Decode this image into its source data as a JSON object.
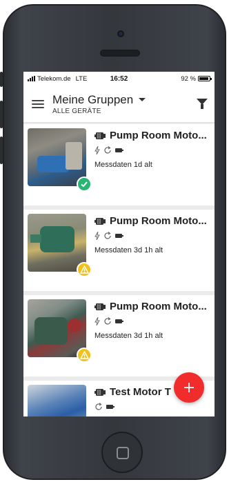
{
  "status_bar": {
    "carrier": "Telekom.de",
    "network": "LTE",
    "time": "16:52",
    "battery_text": "92 %",
    "battery_level": 0.92
  },
  "app_bar": {
    "title": "Meine Gruppen",
    "subtitle": "ALLE GERÄTE",
    "menu_icon": "hamburger-menu-icon",
    "filter_icon": "filter-funnel-icon"
  },
  "devices": [
    {
      "name": "Pump Room Moto...",
      "age": "Messdaten 1d alt",
      "status": "ok"
    },
    {
      "name": "Pump Room Moto...",
      "age": "Messdaten 3d 1h alt",
      "status": "warning"
    },
    {
      "name": "Pump Room Moto...",
      "age": "Messdaten 3d 1h alt",
      "status": "warning"
    },
    {
      "name": "Test Motor T",
      "age": "",
      "status": ""
    }
  ],
  "fab": {
    "icon": "plus-icon"
  },
  "colors": {
    "status_ok": "#29b673",
    "status_warning": "#f3c21a",
    "fab": "#f02c2c"
  }
}
